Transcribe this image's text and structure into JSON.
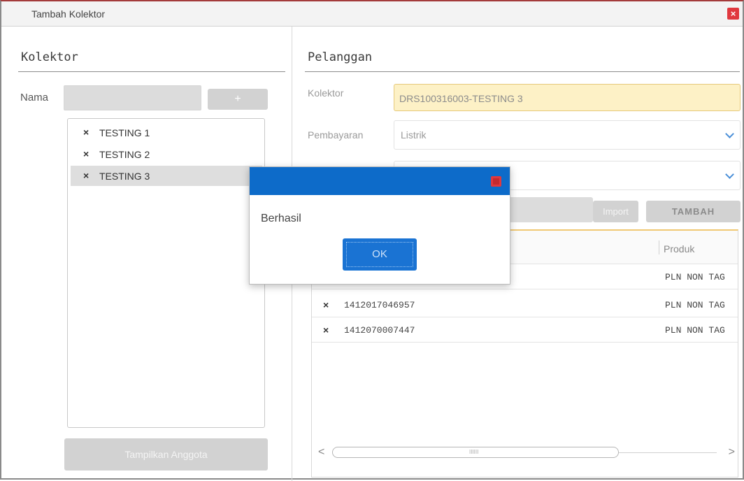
{
  "window": {
    "title": "Tambah Kolektor",
    "close_glyph": "×"
  },
  "kolektor_panel": {
    "heading": "Kolektor",
    "name_label": "Nama",
    "name_value": "",
    "add_label": "+",
    "members": [
      "TESTING 1",
      "TESTING 2",
      "TESTING 3"
    ],
    "selected_member": "TESTING 3",
    "remove_glyph": "×",
    "show_members_label": "Tampilkan Anggota"
  },
  "pelanggan_panel": {
    "heading": "Pelanggan",
    "kolektor_label": "Kolektor",
    "kolektor_value": "DRS100316003-TESTING 3",
    "pembayaran_label": "Pembayaran",
    "pembayaran_value": "Listrik",
    "second_select_value": "",
    "import_label": "Import",
    "tambah_label": "TAMBAH",
    "grid": {
      "columns": [
        "",
        "Produk"
      ],
      "rows": [
        {
          "id": "",
          "produk": "PLN NON TAG"
        },
        {
          "id": "1412017046957",
          "produk": "PLN NON TAG"
        },
        {
          "id": "1412070007447",
          "produk": "PLN NON TAG"
        }
      ],
      "scroll_left": "<",
      "scroll_right": ">",
      "scroll_grip": "IIIIII"
    }
  },
  "dialog": {
    "message": "Berhasil",
    "ok_label": "OK"
  },
  "colors": {
    "dialog_header": "#0d6bc9",
    "close_red": "#e0383e",
    "highlight_field": "#fdf1c6",
    "accent_chevron": "#4a8fd8"
  }
}
